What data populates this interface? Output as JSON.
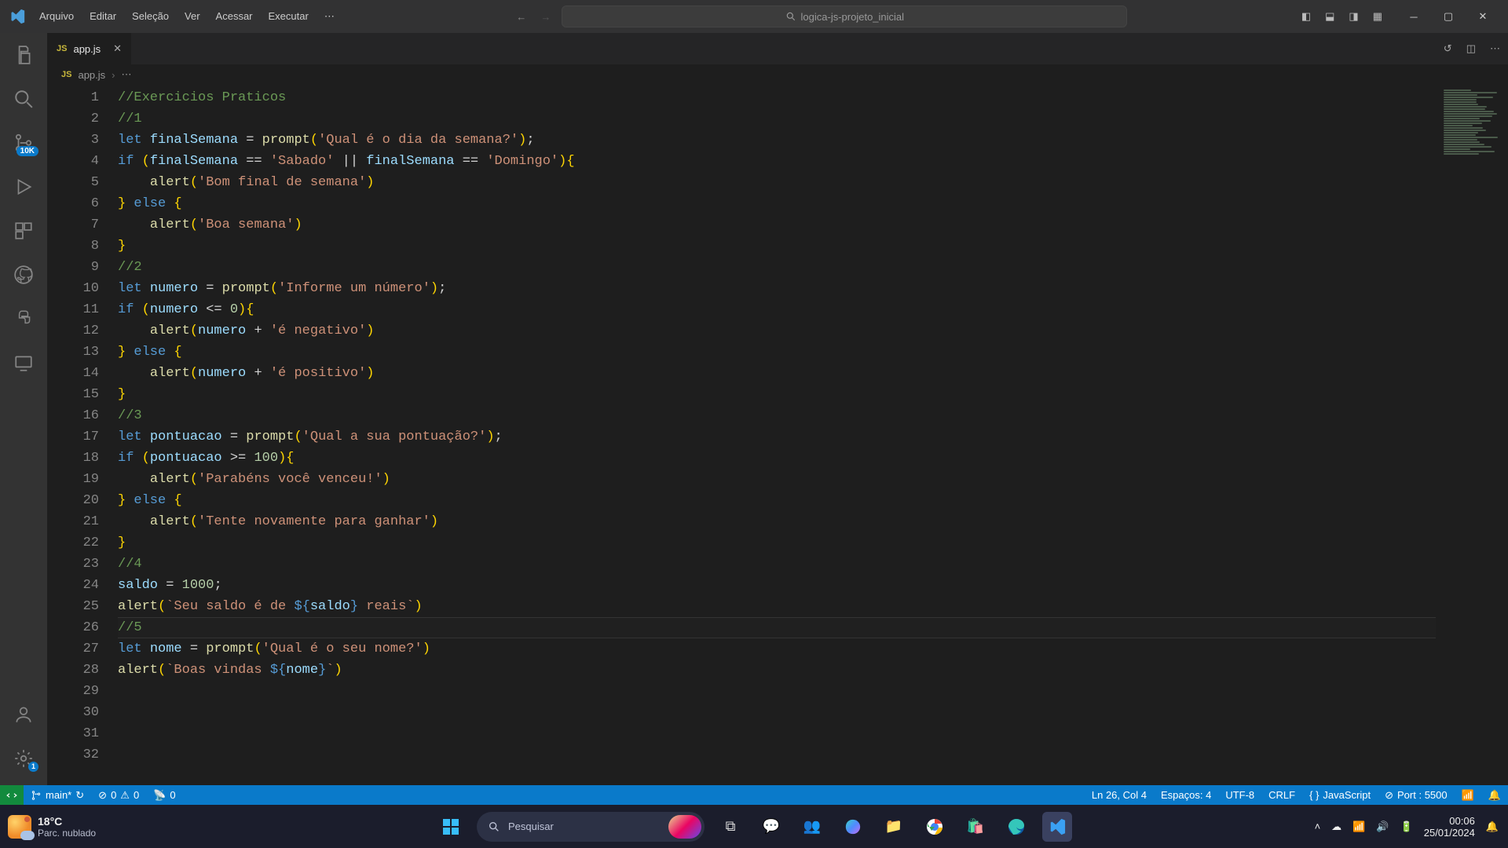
{
  "menubar": {
    "items": [
      "Arquivo",
      "Editar",
      "Seleção",
      "Ver",
      "Acessar",
      "Executar",
      "⋯"
    ]
  },
  "search": {
    "placeholder": "logica-js-projeto_inicial"
  },
  "tab": {
    "filename": "app.js",
    "icon": "JS"
  },
  "breadcrumb": {
    "file": "app.js",
    "tail": "⋯"
  },
  "activity_badges": {
    "source_control": "10K",
    "settings": "1"
  },
  "code_lines": [
    {
      "n": 1,
      "cls": "cmt",
      "t": "//Exercicios Praticos"
    },
    {
      "n": 2,
      "cls": "cmt",
      "t": "//1"
    },
    {
      "n": 3,
      "segs": [
        {
          "c": "kw",
          "t": "let "
        },
        {
          "c": "var",
          "t": "finalSemana"
        },
        {
          "c": "op",
          "t": " = "
        },
        {
          "c": "fn",
          "t": "prompt"
        },
        {
          "c": "par1",
          "t": "("
        },
        {
          "c": "str",
          "t": "'Qual é o dia da semana?'"
        },
        {
          "c": "par1",
          "t": ")"
        },
        {
          "c": "pn",
          "t": ";"
        }
      ]
    },
    {
      "n": 4,
      "segs": [
        {
          "c": "kw",
          "t": "if "
        },
        {
          "c": "par1",
          "t": "("
        },
        {
          "c": "var",
          "t": "finalSemana"
        },
        {
          "c": "op",
          "t": " == "
        },
        {
          "c": "str",
          "t": "'Sabado'"
        },
        {
          "c": "op",
          "t": " || "
        },
        {
          "c": "var",
          "t": "finalSemana"
        },
        {
          "c": "op",
          "t": " == "
        },
        {
          "c": "str",
          "t": "'Domingo'"
        },
        {
          "c": "par1",
          "t": ")"
        },
        {
          "c": "brc1",
          "t": "{"
        }
      ]
    },
    {
      "n": 5,
      "indent": 1,
      "segs": [
        {
          "c": "fn",
          "t": "alert"
        },
        {
          "c": "par1",
          "t": "("
        },
        {
          "c": "str",
          "t": "'Bom final de semana'"
        },
        {
          "c": "par1",
          "t": ")"
        }
      ]
    },
    {
      "n": 6,
      "segs": [
        {
          "c": "brc1",
          "t": "}"
        },
        {
          "c": "kw",
          "t": " else "
        },
        {
          "c": "brc1",
          "t": "{"
        }
      ]
    },
    {
      "n": 7,
      "indent": 1,
      "segs": [
        {
          "c": "fn",
          "t": "alert"
        },
        {
          "c": "par1",
          "t": "("
        },
        {
          "c": "str",
          "t": "'Boa semana'"
        },
        {
          "c": "par1",
          "t": ")"
        }
      ]
    },
    {
      "n": 8,
      "segs": [
        {
          "c": "brc1",
          "t": "}"
        }
      ]
    },
    {
      "n": 9,
      "cls": "cmt",
      "t": "//2"
    },
    {
      "n": 10,
      "segs": [
        {
          "c": "kw",
          "t": "let "
        },
        {
          "c": "var",
          "t": "numero"
        },
        {
          "c": "op",
          "t": " = "
        },
        {
          "c": "fn",
          "t": "prompt"
        },
        {
          "c": "par1",
          "t": "("
        },
        {
          "c": "str",
          "t": "'Informe um número'"
        },
        {
          "c": "par1",
          "t": ")"
        },
        {
          "c": "pn",
          "t": ";"
        }
      ]
    },
    {
      "n": 11,
      "segs": [
        {
          "c": "kw",
          "t": "if "
        },
        {
          "c": "par1",
          "t": "("
        },
        {
          "c": "var",
          "t": "numero"
        },
        {
          "c": "op",
          "t": " <= "
        },
        {
          "c": "num",
          "t": "0"
        },
        {
          "c": "par1",
          "t": ")"
        },
        {
          "c": "brc1",
          "t": "{"
        }
      ]
    },
    {
      "n": 12,
      "indent": 1,
      "segs": [
        {
          "c": "fn",
          "t": "alert"
        },
        {
          "c": "par1",
          "t": "("
        },
        {
          "c": "var",
          "t": "numero"
        },
        {
          "c": "op",
          "t": " + "
        },
        {
          "c": "str",
          "t": "'é negativo'"
        },
        {
          "c": "par1",
          "t": ")"
        }
      ]
    },
    {
      "n": 13,
      "segs": [
        {
          "c": "brc1",
          "t": "}"
        },
        {
          "c": "kw",
          "t": " else "
        },
        {
          "c": "brc1",
          "t": "{"
        }
      ]
    },
    {
      "n": 14,
      "indent": 1,
      "segs": [
        {
          "c": "fn",
          "t": "alert"
        },
        {
          "c": "par1",
          "t": "("
        },
        {
          "c": "var",
          "t": "numero"
        },
        {
          "c": "op",
          "t": " + "
        },
        {
          "c": "str",
          "t": "'é positivo'"
        },
        {
          "c": "par1",
          "t": ")"
        }
      ]
    },
    {
      "n": 15,
      "segs": [
        {
          "c": "brc1",
          "t": "}"
        }
      ]
    },
    {
      "n": 16,
      "cls": "cmt",
      "t": "//3"
    },
    {
      "n": 17,
      "segs": [
        {
          "c": "kw",
          "t": "let "
        },
        {
          "c": "var",
          "t": "pontuacao"
        },
        {
          "c": "op",
          "t": " = "
        },
        {
          "c": "fn",
          "t": "prompt"
        },
        {
          "c": "par1",
          "t": "("
        },
        {
          "c": "str",
          "t": "'Qual a sua pontuação?'"
        },
        {
          "c": "par1",
          "t": ")"
        },
        {
          "c": "pn",
          "t": ";"
        }
      ]
    },
    {
      "n": 18,
      "segs": [
        {
          "c": "kw",
          "t": "if "
        },
        {
          "c": "par1",
          "t": "("
        },
        {
          "c": "var",
          "t": "pontuacao"
        },
        {
          "c": "op",
          "t": " >= "
        },
        {
          "c": "num",
          "t": "100"
        },
        {
          "c": "par1",
          "t": ")"
        },
        {
          "c": "brc1",
          "t": "{"
        }
      ]
    },
    {
      "n": 19,
      "indent": 1,
      "segs": [
        {
          "c": "fn",
          "t": "alert"
        },
        {
          "c": "par1",
          "t": "("
        },
        {
          "c": "str",
          "t": "'Parabéns você venceu!'"
        },
        {
          "c": "par1",
          "t": ")"
        }
      ]
    },
    {
      "n": 20,
      "segs": [
        {
          "c": "brc1",
          "t": "}"
        },
        {
          "c": "kw",
          "t": " else "
        },
        {
          "c": "brc1",
          "t": "{"
        }
      ]
    },
    {
      "n": 21,
      "indent": 1,
      "segs": [
        {
          "c": "fn",
          "t": "alert"
        },
        {
          "c": "par1",
          "t": "("
        },
        {
          "c": "str",
          "t": "'Tente novamente para ganhar'"
        },
        {
          "c": "par1",
          "t": ")"
        }
      ]
    },
    {
      "n": 22,
      "segs": [
        {
          "c": "brc1",
          "t": "}"
        }
      ]
    },
    {
      "n": 23,
      "cls": "cmt",
      "t": "//4"
    },
    {
      "n": 24,
      "segs": [
        {
          "c": "var",
          "t": "saldo"
        },
        {
          "c": "op",
          "t": " = "
        },
        {
          "c": "num",
          "t": "1000"
        },
        {
          "c": "pn",
          "t": ";"
        }
      ]
    },
    {
      "n": 25,
      "segs": [
        {
          "c": "fn",
          "t": "alert"
        },
        {
          "c": "par1",
          "t": "("
        },
        {
          "c": "str",
          "t": "`Seu saldo é de "
        },
        {
          "c": "kw",
          "t": "${"
        },
        {
          "c": "var",
          "t": "saldo"
        },
        {
          "c": "kw",
          "t": "}"
        },
        {
          "c": "str",
          "t": " reais`"
        },
        {
          "c": "par1",
          "t": ")"
        }
      ]
    },
    {
      "n": 26,
      "cls": "cmt",
      "t": "//5",
      "current": true
    },
    {
      "n": 27,
      "segs": [
        {
          "c": "kw",
          "t": "let "
        },
        {
          "c": "var",
          "t": "nome"
        },
        {
          "c": "op",
          "t": " = "
        },
        {
          "c": "fn",
          "t": "prompt"
        },
        {
          "c": "par1",
          "t": "("
        },
        {
          "c": "str",
          "t": "'Qual é o seu nome?'"
        },
        {
          "c": "par1",
          "t": ")"
        }
      ]
    },
    {
      "n": 28,
      "segs": [
        {
          "c": "fn",
          "t": "alert"
        },
        {
          "c": "par1",
          "t": "("
        },
        {
          "c": "str",
          "t": "`Boas vindas "
        },
        {
          "c": "kw",
          "t": "${"
        },
        {
          "c": "var",
          "t": "nome"
        },
        {
          "c": "kw",
          "t": "}"
        },
        {
          "c": "str",
          "t": "`"
        },
        {
          "c": "par1",
          "t": ")"
        }
      ]
    },
    {
      "n": 29,
      "t": ""
    },
    {
      "n": 30,
      "t": ""
    },
    {
      "n": 31,
      "t": ""
    },
    {
      "n": 32,
      "t": ""
    }
  ],
  "status": {
    "branch": "main*",
    "sync": "↻",
    "errors": "0",
    "warnings": "0",
    "ports": "0",
    "ln_col": "Ln 26, Col 4",
    "spaces": "Espaços: 4",
    "encoding": "UTF-8",
    "eol": "CRLF",
    "language": "JavaScript",
    "port": "Port : 5500"
  },
  "taskbar": {
    "temp": "18°C",
    "weather_label": "Parc. nublado",
    "search_placeholder": "Pesquisar",
    "time": "00:06",
    "date": "25/01/2024"
  }
}
